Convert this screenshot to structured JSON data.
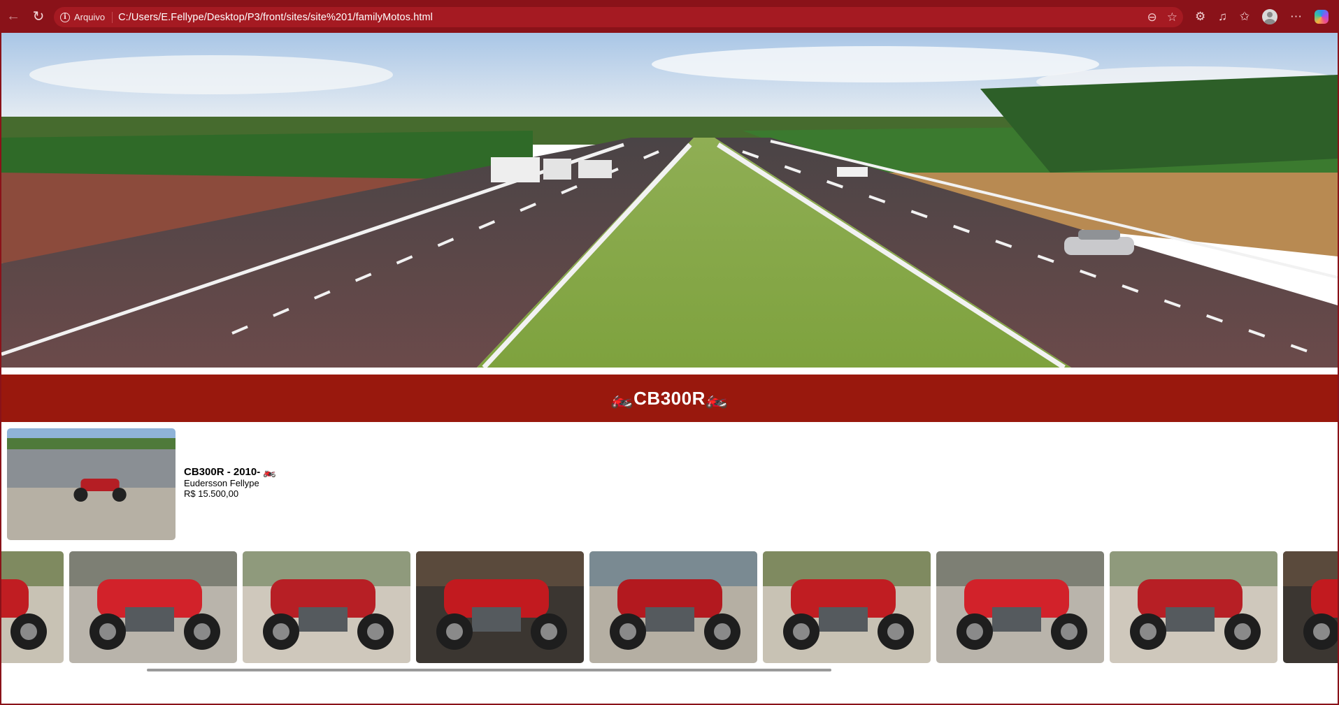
{
  "browser": {
    "site_label": "Arquivo",
    "url": "C:/Users/E.Fellype/Desktop/P3/front/sites/site%201/familyMotos.html",
    "accent": "#8a1219"
  },
  "header": {
    "title": "🏍️CB300R🏍️",
    "bar_color": "#99180d"
  },
  "listing": {
    "title": "CB300R - 2010- 🏍️",
    "seller": "Eudersson Fellype",
    "price": "R$ 15.500,00"
  },
  "gallery": {
    "photos": [
      {
        "icon": "motorcycle-side-photo"
      },
      {
        "icon": "motorcycle-closeup-photo"
      },
      {
        "icon": "motorcycle-rear-photo"
      },
      {
        "icon": "motorcycle-dark-photo"
      },
      {
        "icon": "motorcycle-wall-photo"
      },
      {
        "icon": "motorcycle-side-photo"
      },
      {
        "icon": "motorcycle-closeup-photo"
      },
      {
        "icon": "motorcycle-rear-photo"
      },
      {
        "icon": "motorcycle-dark-photo"
      }
    ]
  }
}
